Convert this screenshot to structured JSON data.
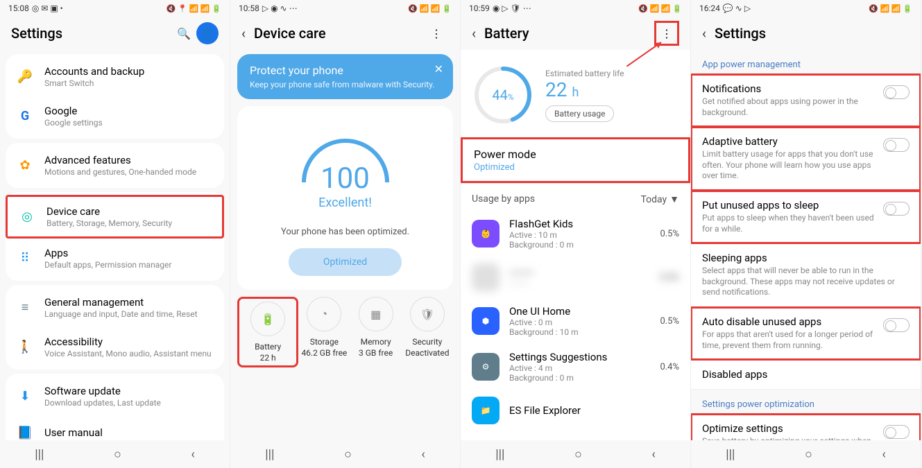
{
  "screen1": {
    "status": {
      "time": "15:08",
      "icons": "◎ ✉ ▣ •",
      "right": "🔇 📍 📶 📶 🔋"
    },
    "title": "Settings",
    "items": [
      {
        "icon": "🔑",
        "iconColor": "#2962ff",
        "title": "Accounts and backup",
        "sub": "Smart Switch"
      },
      {
        "icon": "G",
        "iconColor": "#1a73e8",
        "title": "Google",
        "sub": "Google settings"
      },
      {
        "icon": "✿",
        "iconColor": "#ff9800",
        "title": "Advanced features",
        "sub": "Motions and gestures, One-handed mode"
      },
      {
        "icon": "◎",
        "iconColor": "#00bfa5",
        "title": "Device care",
        "sub": "Battery, Storage, Memory, Security",
        "highlight": true
      },
      {
        "icon": "⠿",
        "iconColor": "#2196f3",
        "title": "Apps",
        "sub": "Default apps, Permission manager"
      },
      {
        "icon": "⚙",
        "iconColor": "#607d8b",
        "title": "General management",
        "sub": "Language and input, Date and time, Reset"
      },
      {
        "icon": "🚶",
        "iconColor": "#4caf50",
        "title": "Accessibility",
        "sub": "Voice Assistant, Mono audio, Assistant menu"
      },
      {
        "icon": "⬇",
        "iconColor": "#2196f3",
        "title": "Software update",
        "sub": "Download updates, Last update"
      },
      {
        "icon": "📘",
        "iconColor": "#ff9800",
        "title": "User manual",
        "sub": ""
      }
    ]
  },
  "screen2": {
    "status": {
      "time": "10:58",
      "icons": "▷ ◉ ∿ ⋯",
      "right": "🔇 📶 📶 🔋"
    },
    "title": "Device care",
    "banner": {
      "title": "Protect your phone",
      "sub": "Keep your phone safe from malware with Security."
    },
    "score": "100",
    "scoreLabel": "Excellent!",
    "optimizedText": "Your phone has been optimized.",
    "optBtn": "Optimized",
    "tiles": [
      {
        "icon": "🔋",
        "label": "Battery",
        "value": "22 h",
        "highlight": true
      },
      {
        "icon": "◔",
        "label": "Storage",
        "value": "46.2 GB free"
      },
      {
        "icon": "▦",
        "label": "Memory",
        "value": "3 GB free"
      },
      {
        "icon": "🛡",
        "label": "Security",
        "value": "Deactivated"
      }
    ]
  },
  "screen3": {
    "status": {
      "time": "10:59",
      "icons": "◉ ▷ 🛡 ⋯",
      "right": "🔇 📶 📶 🔋"
    },
    "title": "Battery",
    "pct": "44",
    "pctUnit": "%",
    "estLabel": "Estimated battery life",
    "est": "22",
    "estUnit": "h",
    "usageBtn": "Battery usage",
    "powerMode": {
      "title": "Power mode",
      "status": "Optimized"
    },
    "usageHeader": "Usage by apps",
    "today": "Today",
    "apps": [
      {
        "name": "FlashGet Kids",
        "active": "Active : 10 m",
        "bg": "Background : 0 m",
        "pct": "0.5%",
        "color": "#7c4dff"
      },
      {
        "name": "—",
        "active": "—",
        "bg": "—",
        "pct": "0.5%",
        "color": "#e0e0e0",
        "blur": true
      },
      {
        "name": "One UI Home",
        "active": "Active : 0 m",
        "bg": "Background : 10 m",
        "pct": "0.5%",
        "color": "#2962ff"
      },
      {
        "name": "Settings Suggestions",
        "active": "Active : 4 m",
        "bg": "Background : 0 m",
        "pct": "0.4%",
        "color": "#607d8b"
      },
      {
        "name": "ES File Explorer",
        "active": "",
        "bg": "",
        "pct": "",
        "color": "#03a9f4"
      }
    ]
  },
  "screen4": {
    "status": {
      "time": "16:24",
      "icons": "💬 ∿ ▷",
      "right": "🔇 📶 📶 🔋"
    },
    "title": "Settings",
    "section1": "App power management",
    "rows": [
      {
        "title": "Notifications",
        "sub": "Get notified about apps using power in the background.",
        "toggle": true,
        "highlight": true
      },
      {
        "title": "Adaptive battery",
        "sub": "Limit battery usage for apps that you don't use often. Your phone will learn how you use apps over time.",
        "toggle": true,
        "highlight": true
      },
      {
        "title": "Put unused apps to sleep",
        "sub": "Put apps to sleep when they haven't been used for a while.",
        "toggle": true,
        "highlight": true
      },
      {
        "title": "Sleeping apps",
        "sub": "Select apps that will never be able to run in the background. These apps may not receive updates or send notifications.",
        "toggle": false,
        "highlight": false
      },
      {
        "title": "Auto disable unused apps",
        "sub": "For apps that aren't used for a longer period of time, prevent them from running.",
        "toggle": true,
        "highlight": true
      },
      {
        "title": "Disabled apps",
        "sub": "",
        "toggle": false,
        "highlight": false
      }
    ],
    "section2": "Settings power optimization",
    "rows2": [
      {
        "title": "Optimize settings",
        "sub": "Save battery by optimizing your settings when you're not using your phone.",
        "toggle": true,
        "highlight": true
      }
    ]
  },
  "nav": {
    "recent": "|||",
    "home": "○",
    "back": "‹"
  }
}
